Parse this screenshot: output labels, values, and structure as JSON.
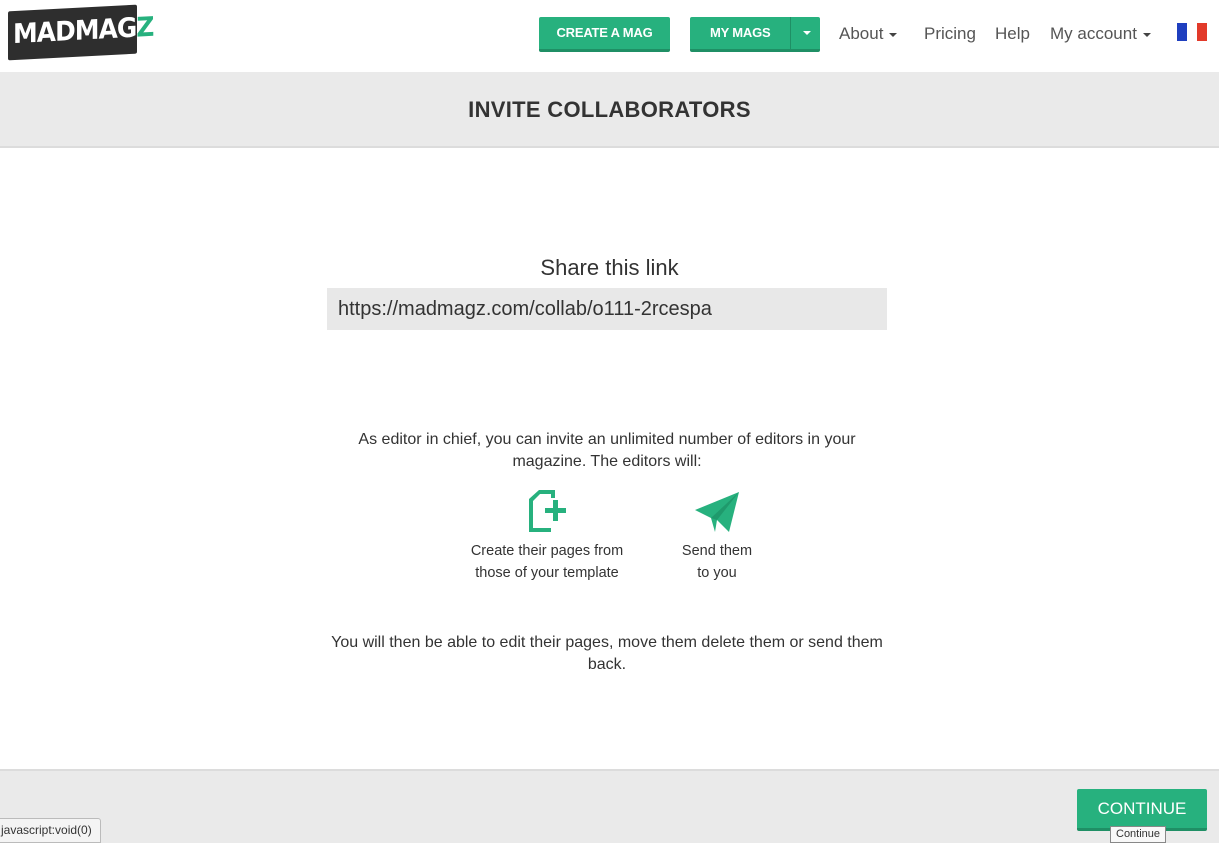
{
  "header": {
    "logo": {
      "text_main": "MADMAG",
      "text_accent": "Z"
    },
    "create_button": "CREATE A MAG",
    "mymags_button": "MY MAGS",
    "nav": {
      "about": "About",
      "pricing": "Pricing",
      "help": "Help",
      "account": "My account"
    },
    "language_flag": "french-flag-icon"
  },
  "page": {
    "title": "INVITE COLLABORATORS",
    "share_label": "Share this link",
    "share_link": "https://madmagz.com/collab/o111-2rcespa",
    "intro": "As editor in chief, you can invite an unlimited number of editors in your magazine. The editors will:",
    "features": [
      {
        "icon": "add-page-icon",
        "line1": "Create their pages from",
        "line2": "those of your template"
      },
      {
        "icon": "paper-plane-icon",
        "line1": "Send them",
        "line2": "to you"
      }
    ],
    "outro": "You will then be able to edit their pages, move them delete them or send them back."
  },
  "footer": {
    "continue_button": "CONTINUE",
    "continue_tooltip": "Continue"
  },
  "browser": {
    "status_url": "javascript:void(0)"
  },
  "colors": {
    "accent": "#27b17e",
    "band": "#eaeaea",
    "text": "#333333"
  }
}
